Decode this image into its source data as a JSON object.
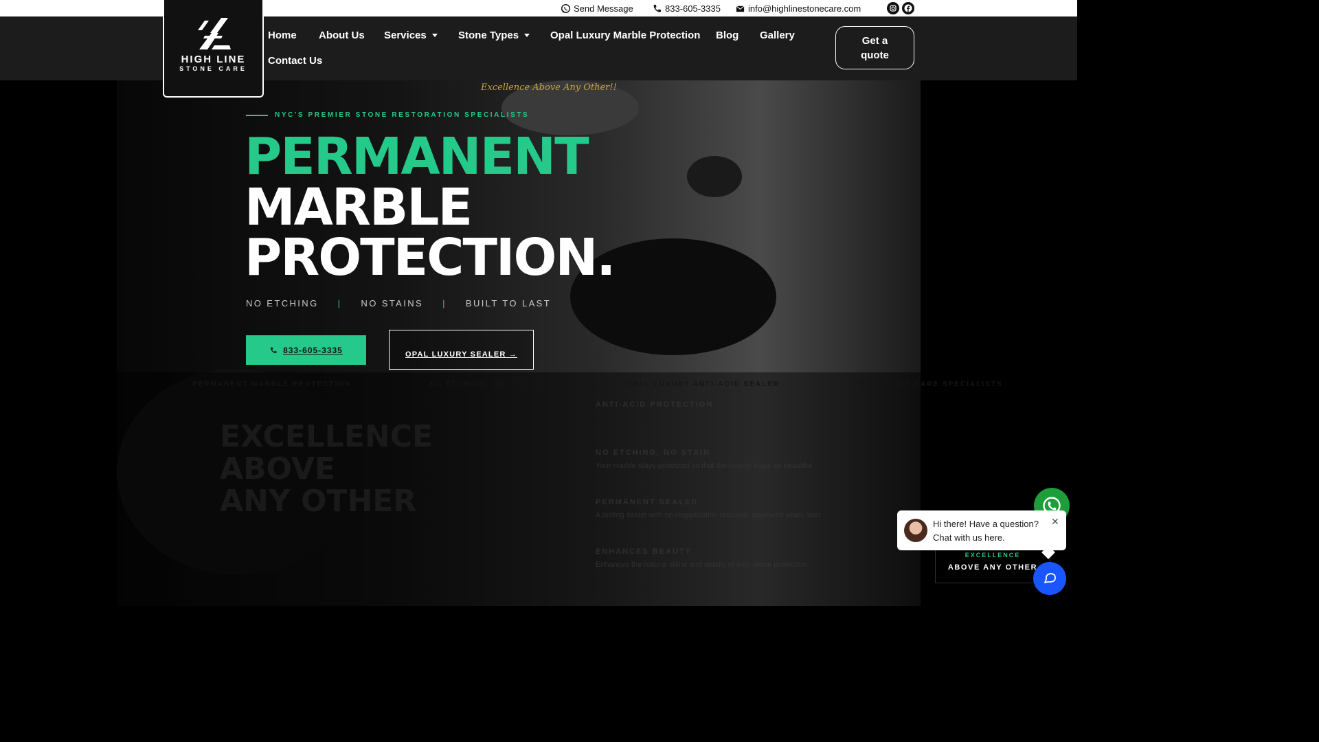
{
  "topbar": {
    "send_message": "Send Message",
    "phone": "833-605-3335",
    "email": "info@highlinestonecare.com",
    "icons": [
      "whatsapp-icon",
      "phone-icon",
      "envelope-icon",
      "instagram-icon",
      "facebook-icon"
    ]
  },
  "logo": {
    "line1": "HIGH LINE",
    "line2": "STONE CARE"
  },
  "nav": {
    "items": [
      {
        "label": "Home"
      },
      {
        "label": "About Us"
      },
      {
        "label": "Services"
      },
      {
        "label": "Stone Types"
      },
      {
        "label": "Opal Luxury Marble Protection"
      },
      {
        "label": "Blog"
      },
      {
        "label": "Gallery"
      },
      {
        "label": "Contact Us"
      }
    ],
    "quote_label": "Get a quote"
  },
  "hero": {
    "tagline": "Excellence Above Any Other!!",
    "eyebrow": "NYC'S PREMIER STONE RESTORATION SPECIALISTS",
    "heading_line1": "PERMANENT",
    "heading_line2": "MARBLE",
    "heading_line3": "PROTECTION.",
    "features": [
      "NO ETCHING",
      "NO STAINS",
      "BUILT TO LAST"
    ],
    "feature_sep": "|",
    "phone_button": "833-605-3335",
    "opal_button": "OPAL LUXURY SEALER →"
  },
  "ticker": [
    "PERMANENT MARBLE PROTECTION",
    "NO ETCHING. NO STAINS.",
    "OPAL LUXURY ANTI-ACID SEALER",
    "NYC STONE CARE SPECIALISTS"
  ],
  "ghost": {
    "heading": [
      "EXCELLENCE",
      "ABOVE",
      "ANY OTHER"
    ],
    "features": [
      {
        "title": "ANTI-ACID PROTECTION"
      },
      {
        "title": "NO ETCHING, NO STAIN",
        "text": "Your marble stays protected so that the beauty stays so beautiful"
      },
      {
        "title": "PERMANENT SEALER",
        "text": "A lasting sealer with no reapplication required, approved years later"
      },
      {
        "title": "ENHANCES BEAUTY",
        "text": "Enhances the natural shine and details of your stone protection"
      }
    ]
  },
  "chat": {
    "line1": "Hi there! Have a question?",
    "line2": "Chat with us here.",
    "close": "✕"
  },
  "badge": {
    "line1": "EXCELLENCE",
    "line2": "ABOVE ANY OTHER"
  },
  "colors": {
    "accent": "#25c98a",
    "nav_bg": "#1c1c1c",
    "gold": "#c9a24a",
    "whatsapp": "#1e9e3a",
    "chat_blue": "#1a56ff"
  }
}
